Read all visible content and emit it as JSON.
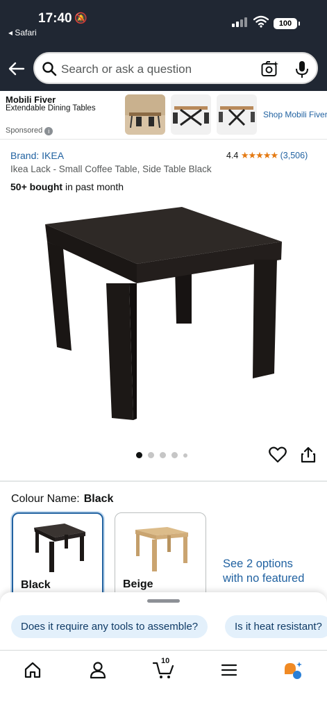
{
  "status_bar": {
    "time": "17:40",
    "back_app": "◂ Safari",
    "battery": "100"
  },
  "search": {
    "placeholder": "Search or ask a question"
  },
  "sponsored": {
    "brand": "Mobili Fiver",
    "title": "Extendable Dining Tables",
    "label": "Sponsored",
    "shop_link": "Shop Mobili Fiver"
  },
  "product": {
    "brand": "Brand: IKEA",
    "rating": "4.4",
    "stars": "★★★★★",
    "review_count": "(3,506)",
    "name": "Ikea Lack - Small Coffee Table, Side Table Black",
    "bought_strong": "50+ bought",
    "bought_rest": " in past month",
    "image_count": 5,
    "active_image": 1
  },
  "colour": {
    "label": "Colour Name:",
    "selected": "Black",
    "options": [
      {
        "name": "Black",
        "color": "#2b2522"
      },
      {
        "name": "Beige",
        "color": "#d8b583"
      }
    ],
    "see_options": "See 2 options with no featured"
  },
  "questions": [
    "Does it require any tools to assemble?",
    "Is it heat resistant?"
  ],
  "cart": {
    "count": "10"
  },
  "tabs": [
    "home-icon",
    "account-icon",
    "cart-icon",
    "menu-icon",
    "rufus-icon"
  ],
  "colors": {
    "link": "#2162a1",
    "star": "#e47911",
    "header": "#202733"
  }
}
